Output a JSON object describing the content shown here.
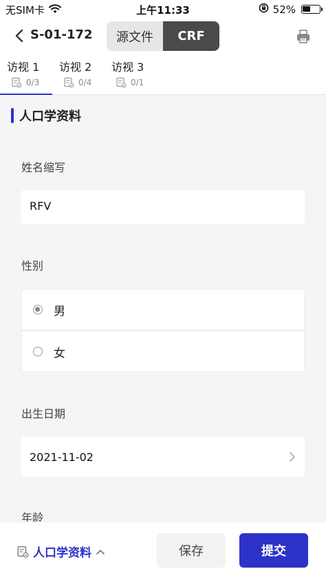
{
  "status_bar": {
    "carrier": "无SIM卡",
    "wifi_icon": "wifi-icon",
    "time": "上午11:33",
    "lock_icon": "orientation-lock-icon",
    "battery_percent": "52%",
    "battery_level": 0.52
  },
  "nav": {
    "title": "S-01-172",
    "back_icon": "chevron-left-icon",
    "segments": [
      {
        "label": "源文件",
        "active": false
      },
      {
        "label": "CRF",
        "active": true
      }
    ],
    "print_icon": "print-icon"
  },
  "visits": [
    {
      "label": "访视 1",
      "count": "0/3",
      "active": true
    },
    {
      "label": "访视 2",
      "count": "0/4",
      "active": false
    },
    {
      "label": "访视 3",
      "count": "0/1",
      "active": false
    }
  ],
  "section": {
    "title": "人口学资料"
  },
  "form": {
    "name_abbr": {
      "label": "姓名缩写",
      "value": "RFV"
    },
    "gender": {
      "label": "性别",
      "options": [
        {
          "label": "男",
          "checked": true
        },
        {
          "label": "女",
          "checked": false
        }
      ]
    },
    "birth_date": {
      "label": "出生日期",
      "value": "2021-11-02"
    },
    "age": {
      "label": "年龄"
    }
  },
  "bottom": {
    "section_label": "人口学资料",
    "save_label": "保存",
    "submit_label": "提交"
  },
  "colors": {
    "accent": "#2d32c8",
    "segment_active": "#4a4a4a",
    "background": "#f5f5f7"
  }
}
